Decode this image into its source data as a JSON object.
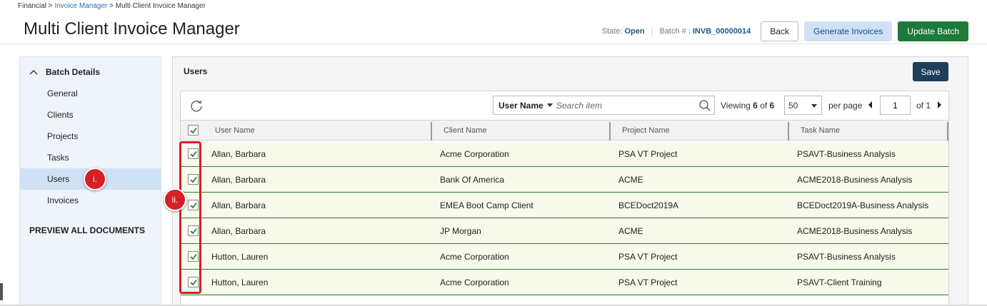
{
  "breadcrumb": {
    "root": "Financial",
    "sep1": " > ",
    "link": "Invoice Manager",
    "sep2": " > ",
    "current": "Multi Client Invoice Manager"
  },
  "page_title": "Multi Client Invoice Manager",
  "header": {
    "state_label": "State:",
    "state_value": "Open",
    "batch_label": "Batch # :",
    "batch_value": "INVB_00000014",
    "back_label": "Back",
    "generate_label": "Generate Invoices",
    "update_label": "Update Batch"
  },
  "sidebar": {
    "section_title": "Batch Details",
    "items": [
      {
        "label": "General"
      },
      {
        "label": "Clients"
      },
      {
        "label": "Projects"
      },
      {
        "label": "Tasks"
      },
      {
        "label": "Users"
      },
      {
        "label": "Invoices"
      }
    ],
    "active_item": "Users",
    "preview_label": "PREVIEW ALL DOCUMENTS"
  },
  "callouts": {
    "one": "i.",
    "two": "ii."
  },
  "panel": {
    "title": "Users",
    "save_label": "Save"
  },
  "grid": {
    "search_field": "User Name",
    "search_placeholder": "Search item",
    "viewing_label": "Viewing",
    "viewing_count": "6",
    "viewing_of": "of",
    "viewing_total": "6",
    "per_page_value": "50",
    "per_page_label": "per page",
    "page_value": "1",
    "page_of": "of 1",
    "columns": [
      "User Name",
      "Client Name",
      "Project Name",
      "Task Name"
    ],
    "rows": [
      {
        "user": "Allan, Barbara",
        "client": "Acme Corporation",
        "project": "PSA VT Project",
        "task": "PSAVT-Business Analysis"
      },
      {
        "user": "Allan, Barbara",
        "client": "Bank Of America",
        "project": "ACME",
        "task": "ACME2018-Business Analysis"
      },
      {
        "user": "Allan, Barbara",
        "client": "EMEA Boot Camp Client",
        "project": "BCEDoct2019A",
        "task": "BCEDoct2019A-Business Analysis"
      },
      {
        "user": "Allan, Barbara",
        "client": "JP Morgan",
        "project": "ACME",
        "task": "ACME2018-Business Analysis"
      },
      {
        "user": "Hutton, Lauren",
        "client": "Acme Corporation",
        "project": "PSA VT Project",
        "task": "PSAVT-Business Analysis"
      },
      {
        "user": "Hutton, Lauren",
        "client": "Acme Corporation",
        "project": "PSA VT Project",
        "task": "PSAVT-Client Training"
      }
    ]
  },
  "colors": {
    "accent_green": "#1d7a38",
    "save_navy": "#1e3e5a",
    "callout_red": "#d62027",
    "active_blue": "#cfe2f5"
  },
  "icons": {
    "refresh": "refresh-icon",
    "search": "search-icon",
    "collapse": "chevron-up-icon",
    "check": "check-icon"
  }
}
